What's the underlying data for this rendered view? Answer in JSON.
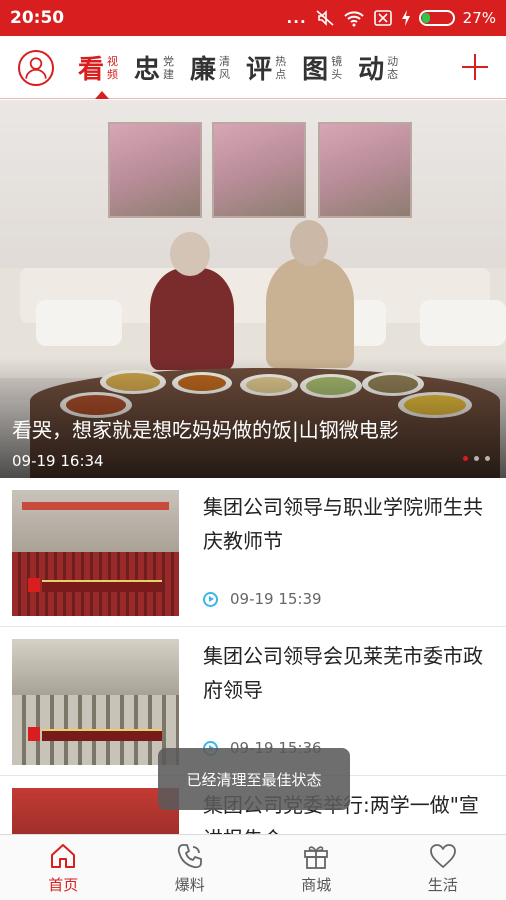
{
  "status_bar": {
    "time": "20:50",
    "more": "...",
    "battery_text": "27%",
    "battery_level": 0.27
  },
  "channels": {
    "tabs": [
      {
        "big": "看",
        "small1": "视",
        "small2": "频",
        "active": true
      },
      {
        "big": "忠",
        "small1": "党",
        "small2": "建",
        "active": false
      },
      {
        "big": "廉",
        "small1": "清",
        "small2": "风",
        "active": false
      },
      {
        "big": "评",
        "small1": "热",
        "small2": "点",
        "active": false
      },
      {
        "big": "图",
        "small1": "镜",
        "small2": "头",
        "active": false
      },
      {
        "big": "动",
        "small1": "动",
        "small2": "态",
        "active": false
      }
    ]
  },
  "banner": {
    "title": "看哭，想家就是想吃妈妈做的饭|山钢微电影",
    "time": "09-19 16:34",
    "slide_count": 3,
    "active_slide": 1
  },
  "news": [
    {
      "title": "集团公司领导与职业学院师生共庆教师节",
      "time": "09-19 15:39"
    },
    {
      "title": "集团公司领导会见莱芜市委市政府领导",
      "time": "09-19 15:36"
    },
    {
      "title": "集团公司党委举行:两学一做\"宣讲报告会",
      "time": ""
    }
  ],
  "toast": "已经清理至最佳状态",
  "bottom_nav": [
    {
      "label": "首页",
      "icon": "home-icon",
      "active": true
    },
    {
      "label": "爆料",
      "icon": "phone-icon",
      "active": false
    },
    {
      "label": "商城",
      "icon": "gift-icon",
      "active": false
    },
    {
      "label": "生活",
      "icon": "heart-icon",
      "active": false
    }
  ],
  "colors": {
    "brand": "#d81e1e",
    "play": "#3db6e6"
  }
}
